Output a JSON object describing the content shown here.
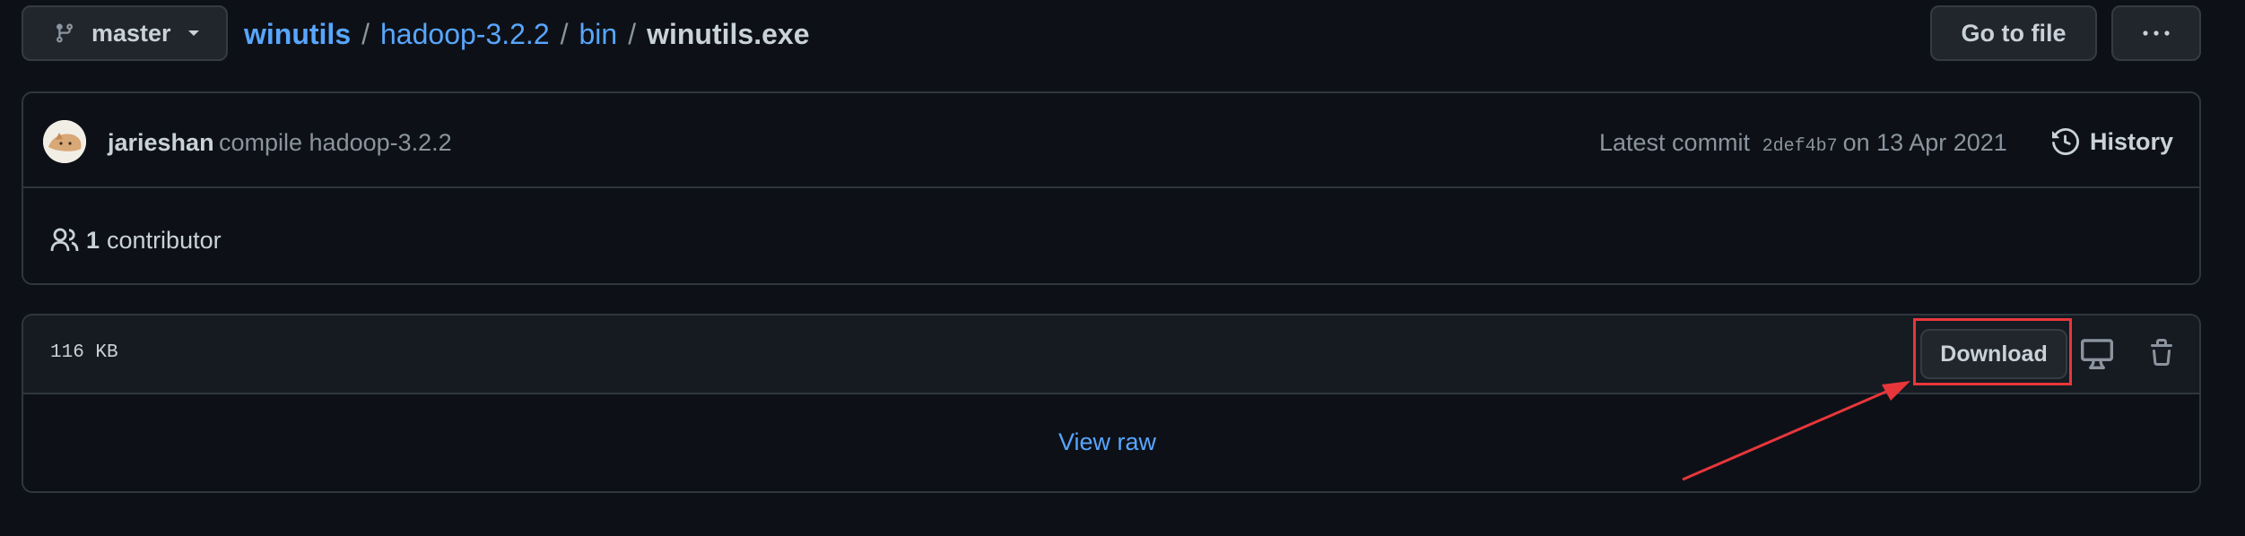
{
  "branch": {
    "name": "master",
    "icon": "git-branch-icon"
  },
  "breadcrumb": {
    "repo": "winutils",
    "folder": "hadoop-3.2.2",
    "subfolder": "bin",
    "file": "winutils.exe",
    "separator": "/"
  },
  "actions": {
    "goto_file": "Go to file",
    "more_icon": "kebab-horizontal-icon"
  },
  "commit": {
    "author": "jarieshan",
    "message": "compile hadoop-3.2.2",
    "latest_label": "Latest commit",
    "sha": "2def4b7",
    "date_prefix": "on",
    "date": "13 Apr 2021",
    "history_label": "History"
  },
  "contributors": {
    "count": "1",
    "label": "contributor"
  },
  "file": {
    "size": "116 KB",
    "download_label": "Download",
    "view_raw_label": "View raw"
  },
  "colors": {
    "background": "#0d1117",
    "link": "#58a6ff",
    "text": "#c9d1d9",
    "muted": "#8b949e",
    "annotation": "#e8363b"
  }
}
